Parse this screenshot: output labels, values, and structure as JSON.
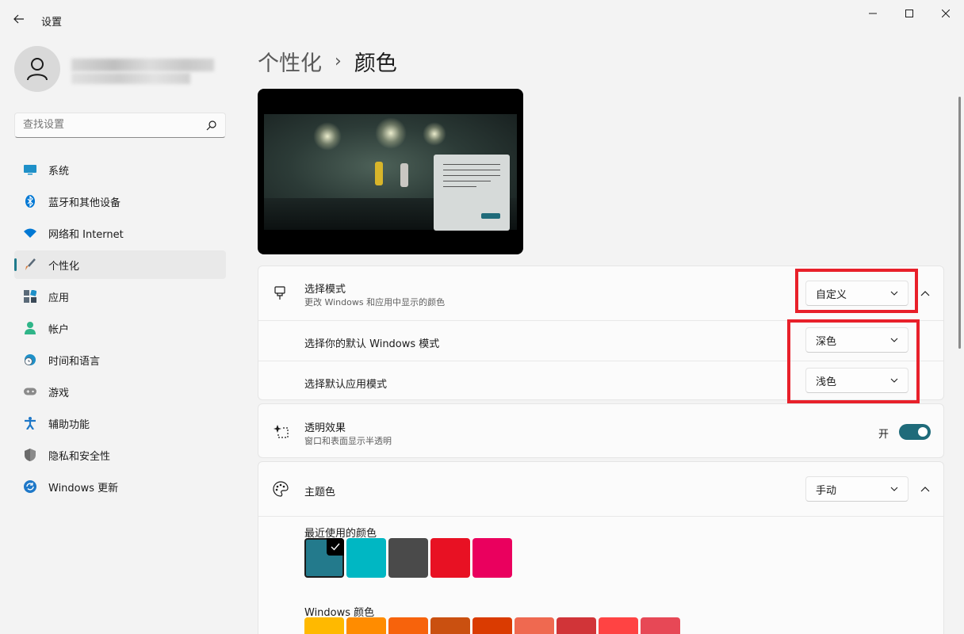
{
  "window": {
    "title": "设置"
  },
  "sidebar": {
    "search_placeholder": "查找设置",
    "items": [
      {
        "label": "系统",
        "icon": "monitor-icon",
        "color": "#1e90c8"
      },
      {
        "label": "蓝牙和其他设备",
        "icon": "bluetooth-icon",
        "color": "#0078d4"
      },
      {
        "label": "网络和 Internet",
        "icon": "wifi-icon",
        "color": "#0078d4"
      },
      {
        "label": "个性化",
        "icon": "brush-icon",
        "color": "#d87b3a",
        "active": true
      },
      {
        "label": "应用",
        "icon": "apps-icon",
        "color": "#5a6a78"
      },
      {
        "label": "帐户",
        "icon": "account-icon",
        "color": "#2fb588"
      },
      {
        "label": "时间和语言",
        "icon": "clock-globe-icon",
        "color": "#1e90c8"
      },
      {
        "label": "游戏",
        "icon": "gamepad-icon",
        "color": "#8a8a8a"
      },
      {
        "label": "辅助功能",
        "icon": "accessibility-icon",
        "color": "#1e78c8"
      },
      {
        "label": "隐私和安全性",
        "icon": "shield-icon",
        "color": "#7a7a7a"
      },
      {
        "label": "Windows 更新",
        "icon": "update-icon",
        "color": "#1e78c8"
      }
    ]
  },
  "breadcrumb": {
    "parent": "个性化",
    "separator": "›",
    "current": "颜色"
  },
  "mode_card": {
    "title": "选择模式",
    "subtitle": "更改 Windows 和应用中显示的颜色",
    "selected": "自定义",
    "windows_mode_label": "选择你的默认 Windows 模式",
    "windows_mode_value": "深色",
    "app_mode_label": "选择默认应用模式",
    "app_mode_value": "浅色"
  },
  "transparency_card": {
    "title": "透明效果",
    "subtitle": "窗口和表面显示半透明",
    "toggle_label": "开",
    "enabled": true
  },
  "accent_card": {
    "title": "主题色",
    "selected": "手动",
    "recent_label": "最近使用的颜色",
    "recent_colors": [
      "#237a8c",
      "#00b7c3",
      "#4a4a4a",
      "#e81123",
      "#ea005e"
    ],
    "windows_colors_label": "Windows 颜色",
    "windows_colors": [
      "#ffb900",
      "#ff8c00",
      "#f7630c",
      "#ca5010",
      "#da3b01",
      "#ef6950",
      "#d13438",
      "#ff4343",
      "#e74856"
    ]
  },
  "colors": {
    "accent": "#1f6b7a",
    "highlight": "#e8202a"
  }
}
